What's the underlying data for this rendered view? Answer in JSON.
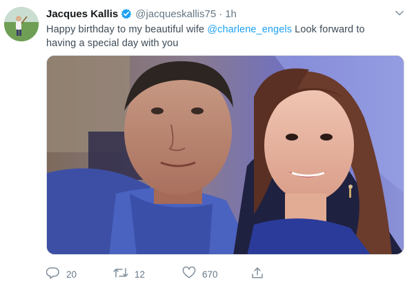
{
  "tweet": {
    "display_name": "Jacques Kallis",
    "handle": "@jacqueskallis75",
    "separator": "·",
    "time": "1h",
    "text_before": "Happy birthday to my beautiful wife ",
    "mention": "@charlene_engels",
    "text_after": " Look forward to having a special day with you"
  },
  "actions": {
    "replies": "20",
    "retweets": "12",
    "likes": "670"
  },
  "colors": {
    "link": "#1da1f2",
    "verified": "#1da1f2",
    "muted": "#657786",
    "name": "#14171a"
  },
  "icons": {
    "verified": "verified-badge-icon",
    "caret": "chevron-down-icon",
    "reply": "reply-icon",
    "retweet": "retweet-icon",
    "like": "heart-icon",
    "share": "share-icon"
  }
}
